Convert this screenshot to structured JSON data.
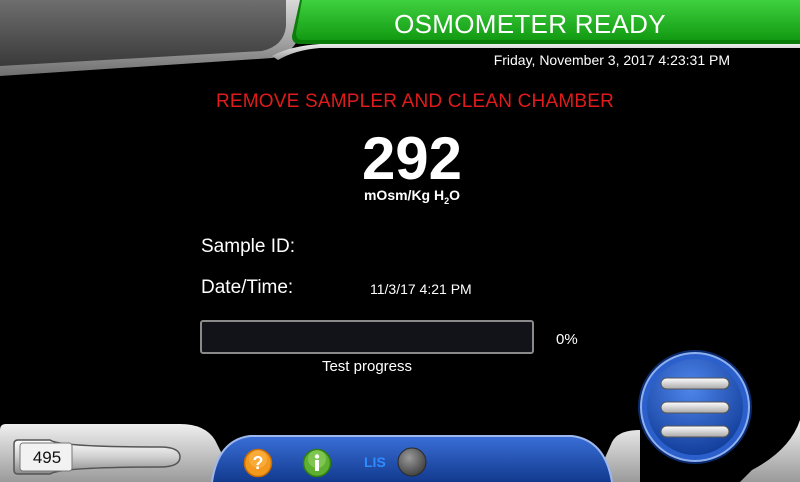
{
  "status": {
    "title": "OSMOMETER READY",
    "datetime": "Friday, November 3, 2017 4:23:31 PM"
  },
  "warning": {
    "message": "REMOVE SAMPLER AND CLEAN CHAMBER"
  },
  "result": {
    "value": "292",
    "unit_main": "mOsm/Kg H",
    "unit_sub": "2",
    "unit_tail": "O"
  },
  "fields": {
    "sample_id_label": "Sample ID:",
    "sample_id_value": "",
    "datetime_label": "Date/Time:",
    "datetime_value": "11/3/17 4:21 PM"
  },
  "progress": {
    "percent": 0,
    "percent_text": "0%",
    "caption": "Test progress"
  },
  "bottom_bar": {
    "counter": "495",
    "help_icon": "question-icon",
    "info_icon": "info-icon",
    "lis_label": "LIS",
    "lis_status_icon": "status-indicator-icon",
    "lis_status_color": "#5a5a5a"
  },
  "menu": {
    "icon": "hamburger-menu-icon"
  },
  "colors": {
    "status_green": "#1fb51f",
    "warning_red": "#e01b1b",
    "help_orange": "#f39a1e",
    "info_green": "#5fb030",
    "lis_blue": "#2f8cff",
    "menu_blue": "#1d4fb3"
  }
}
